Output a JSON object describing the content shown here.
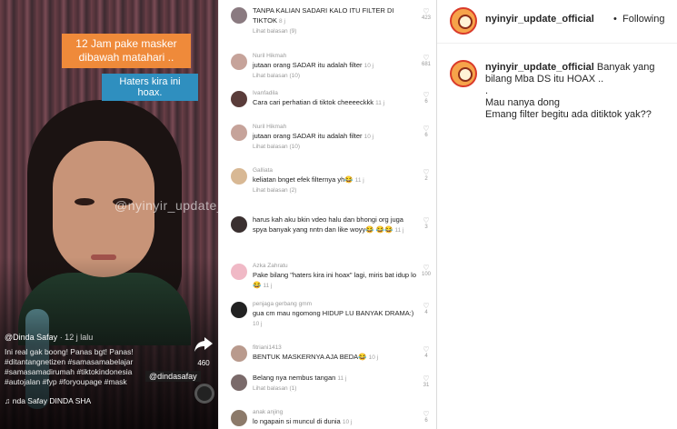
{
  "video": {
    "caption_top": "12 Jam pake masker dibawah matahari ..",
    "caption_hoax": "Haters kira ini hoax.",
    "watermark": "@nyinyir_update_official",
    "username": "@Dinda Safay",
    "time": "· 12 j lalu",
    "description": "Ini real gak boong! Panas bgt! Panas! #ditantangnetizen #samasamabelajar #samasamadirumah #tiktokindonesia #autojalan #fyp #foryoupage #mask",
    "tag_badge": "@dindasafay",
    "sound": "♫ nda Safay   DINDA SHA",
    "share_count": "460"
  },
  "comments": [
    {
      "name": "",
      "text": "TANPA KALIAN SADARI KALO ITU FILTER DI TIKTOK",
      "time": "8 j",
      "replies": "Lihat balasan (9)",
      "likes": "423"
    },
    {
      "name": "Nuril Hikmah",
      "text": "jutaan orang SADAR itu adalah filter",
      "time": "10 j",
      "replies": "Lihat balasan (10)",
      "likes": "681"
    },
    {
      "name": "Ivanfadila",
      "text": "Cara cari perhatian di tiktok cheeeeckkk",
      "time": "11 j",
      "replies": "",
      "likes": "6"
    },
    {
      "name": "Nuril Hikmah",
      "text": "jutaan orang SADAR itu adalah filter",
      "time": "10 j",
      "replies": "Lihat balasan (10)",
      "likes": "6"
    },
    {
      "name": "Galliata",
      "text": "keliatan bnget efek filternya yh😂",
      "time": "11 j",
      "replies": "Lihat balasan (2)",
      "likes": "2"
    },
    {
      "name": "",
      "text": "harus kah aku bkin vdeo halu dan bhongi org juga spya banyak yang nntn dan like woyy😂 😂😂",
      "time": "11 j",
      "replies": "",
      "likes": "3"
    },
    {
      "name": "Azka Zahratu",
      "text": "Pake bilang \"haters kira ini hoax\" lagi, miris bat idup lo😂",
      "time": "11 j",
      "replies": "",
      "likes": "100"
    },
    {
      "name": "penjaga gerbang gmm",
      "text": "gua cm mau ngomong HIDUP LU BANYAK DRAMA:)",
      "time": "10 j",
      "replies": "",
      "likes": "4"
    },
    {
      "name": "fitriani1413",
      "text": "BENTUK MASKERNYA AJA BEDA😂",
      "time": "10 j",
      "replies": "",
      "likes": "4"
    },
    {
      "name": "",
      "text": "Belang nya nembus tangan",
      "time": "11 j",
      "replies": "Lihat balasan (1)",
      "likes": "31"
    },
    {
      "name": "anak anjing",
      "text": "lo ngapain si muncul di dunia",
      "time": "10 j",
      "replies": "",
      "likes": "6"
    }
  ],
  "instagram": {
    "username": "nyinyir_update_official",
    "dot": "•",
    "follow_status": "Following",
    "caption_user": "nyinyir_update_official",
    "caption_line1": "Banyak yang bilang Mba DS itu HOAX ..",
    "caption_line2": ".",
    "caption_line3": "Mau nanya dong",
    "caption_line4": "Emang filter begitu ada ditiktok yak??"
  }
}
